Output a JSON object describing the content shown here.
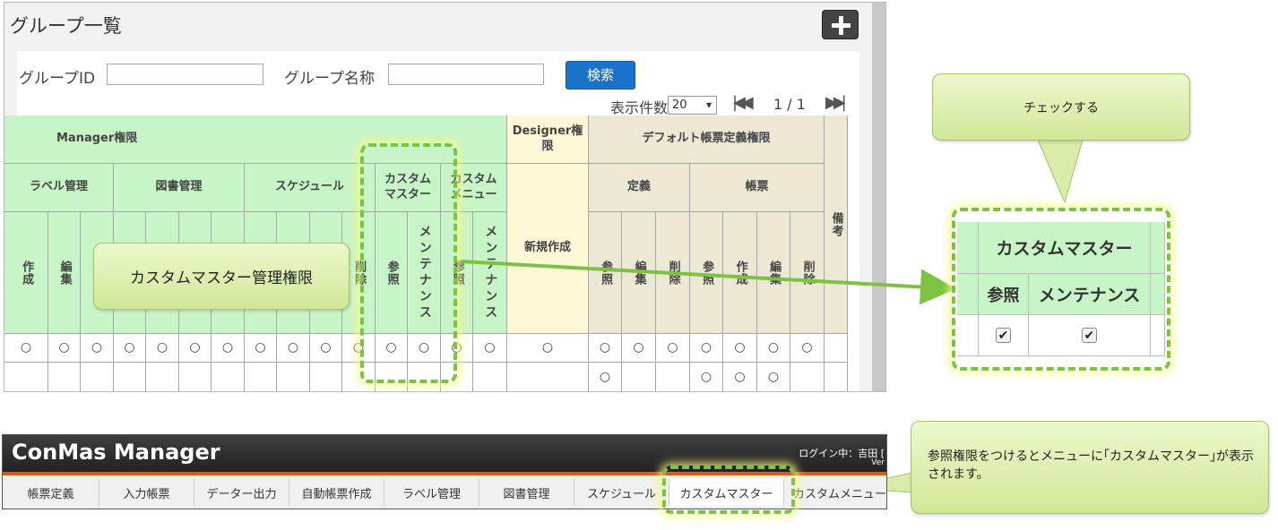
{
  "panel": {
    "title": "グループ一覧",
    "group_id_label": "グループID",
    "group_id_value": "",
    "group_name_label": "グループ名称",
    "group_name_value": "",
    "search_label": "検索",
    "per_page_label": "表示件数",
    "per_page_value": "20",
    "first_page_glyph": "|◀◀",
    "page_info": "1 / 1",
    "last_page_glyph": "▶▶|"
  },
  "table": {
    "manager": "Manager権限",
    "label_mgmt": "ラベル管理",
    "library_mgmt": "図書管理",
    "schedule": "スケジュール",
    "custom_master": "カスタム\nマスター",
    "custom_menu": "カスタム\nメニュー",
    "create": "作成",
    "edit": "編集",
    "delete": "削除",
    "ref": "参照",
    "maintenance": "メンテナンス",
    "designer": "Designer権限",
    "new_create": "新規作成",
    "default_form": "デフォルト帳票定義権限",
    "definition": "定義",
    "form": "帳票",
    "remarks": "備考",
    "circle": "○"
  },
  "callouts": {
    "custom_master_label": "カスタムマスター管理権限",
    "check_label": "チェックする",
    "menu_note": "参照権限をつけるとメニューに｢カスタムマスター｣が表示されます。"
  },
  "zoom": {
    "header": "カスタムマスター",
    "ref": "参照",
    "maintenance": "メンテナンス",
    "ref_checked": "✔",
    "maint_checked": "✔"
  },
  "app": {
    "title": "ConMas Manager",
    "login": "ログイン中：吉田 [",
    "version": "Ver",
    "nav": [
      "帳票定義",
      "入力帳票",
      "データー出力",
      "自動帳票作成",
      "ラベル管理",
      "図書管理",
      "スケジュール",
      "カスタムマスター",
      "カスタムメニュー"
    ]
  },
  "colors": {
    "accent_green": "#7dc243",
    "search_blue": "#1a73c8",
    "manager_green": "#c8f5c8",
    "designer_yellow": "#fef8d6",
    "default_form_tan": "#ece8d4",
    "app_accent": "#d95a1a"
  }
}
